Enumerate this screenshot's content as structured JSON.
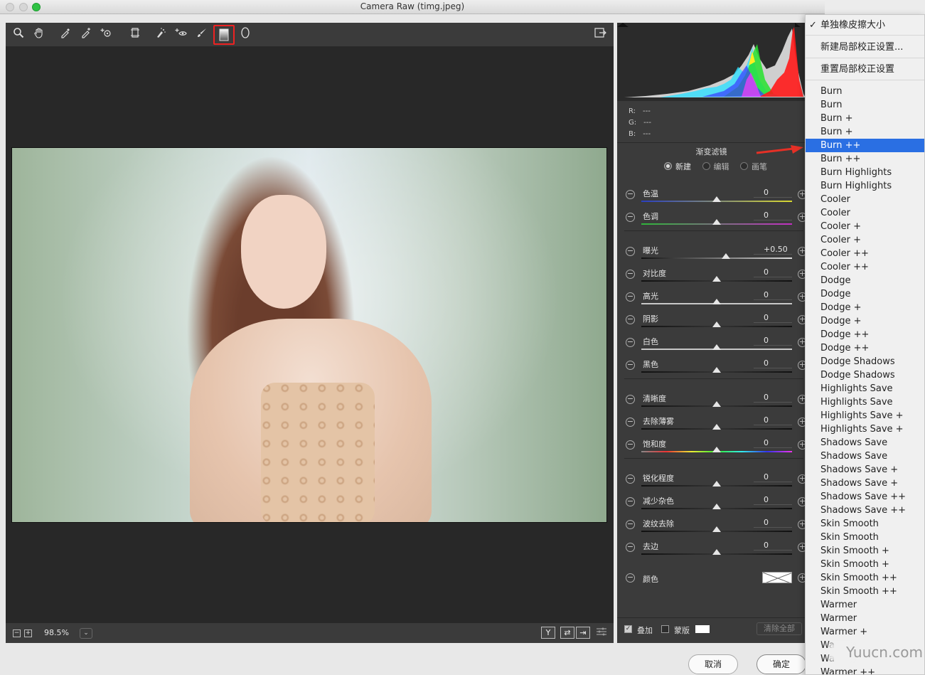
{
  "window": {
    "title": "Camera Raw (timg.jpeg)"
  },
  "toolbar": {
    "tools": [
      "zoom-icon",
      "hand-icon",
      "white-balance-icon",
      "color-sampler-icon",
      "targeted-adjustment-icon",
      "transform-icon",
      "spot-removal-icon",
      "red-eye-icon",
      "adjustment-brush-icon",
      "graduated-filter-icon",
      "radial-filter-icon"
    ],
    "active_tool": "graduated-filter-icon"
  },
  "status": {
    "zoom": "98.5%"
  },
  "histogram": {
    "r_label": "R:",
    "g_label": "G:",
    "b_label": "B:",
    "r": "---",
    "g": "---",
    "b": "---"
  },
  "panel": {
    "title": "渐变滤镜",
    "modes": [
      {
        "label": "新建",
        "selected": true
      },
      {
        "label": "编辑",
        "selected": false
      },
      {
        "label": "画笔",
        "selected": false
      }
    ],
    "sliders": [
      {
        "label": "色温",
        "value": "0",
        "level": 0.5,
        "track": "temp"
      },
      {
        "label": "色调",
        "value": "0",
        "level": 0.5,
        "track": "tint"
      },
      {
        "label": "曝光",
        "value": "+0.50",
        "level": 0.56,
        "track": "exposure"
      },
      {
        "label": "对比度",
        "value": "0",
        "level": 0.5,
        "track": "dark"
      },
      {
        "label": "高光",
        "value": "0",
        "level": 0.5,
        "track": "light"
      },
      {
        "label": "阴影",
        "value": "0",
        "level": 0.5,
        "track": "dark"
      },
      {
        "label": "白色",
        "value": "0",
        "level": 0.5,
        "track": "light"
      },
      {
        "label": "黑色",
        "value": "0",
        "level": 0.5,
        "track": "dark"
      },
      {
        "label": "清晰度",
        "value": "0",
        "level": 0.5,
        "track": "dark"
      },
      {
        "label": "去除薄雾",
        "value": "0",
        "level": 0.5,
        "track": "dark"
      },
      {
        "label": "饱和度",
        "value": "0",
        "level": 0.5,
        "track": "sat"
      },
      {
        "label": "锐化程度",
        "value": "0",
        "level": 0.5,
        "track": "dark"
      },
      {
        "label": "减少杂色",
        "value": "0",
        "level": 0.5,
        "track": "dark"
      },
      {
        "label": "波纹去除",
        "value": "0",
        "level": 0.5,
        "track": "dark"
      },
      {
        "label": "去边",
        "value": "0",
        "level": 0.5,
        "track": "dark"
      }
    ],
    "color_label": "颜色",
    "overlay_label": "叠加",
    "mask_label": "蒙版",
    "clear_all": "清除全部"
  },
  "buttons": {
    "cancel": "取消",
    "ok": "确定"
  },
  "menu": {
    "top_items": [
      "单独橡皮擦大小",
      "新建局部校正设置...",
      "重置局部校正设置"
    ],
    "checked_index": 0,
    "presets": [
      "Burn",
      "Burn",
      "Burn +",
      "Burn +",
      "Burn ++",
      "Burn ++",
      "Burn Highlights",
      "Burn Highlights",
      "Cooler",
      "Cooler",
      "Cooler +",
      "Cooler +",
      "Cooler ++",
      "Cooler ++",
      "Dodge",
      "Dodge",
      "Dodge +",
      "Dodge +",
      "Dodge ++",
      "Dodge ++",
      "Dodge Shadows",
      "Dodge Shadows",
      "Highlights Save",
      "Highlights Save",
      "Highlights Save +",
      "Highlights Save +",
      "Shadows Save",
      "Shadows Save",
      "Shadows Save +",
      "Shadows Save +",
      "Shadows Save ++",
      "Shadows Save ++",
      "Skin Smooth",
      "Skin Smooth",
      "Skin Smooth +",
      "Skin Smooth +",
      "Skin Smooth ++",
      "Skin Smooth ++",
      "Warmer",
      "Warmer",
      "Warmer +",
      "Wa",
      "Wa",
      "Warmer ++"
    ],
    "highlighted_index": 4
  },
  "watermark": "Yuucn.com",
  "colors": {
    "highlight": "#2a6fe3",
    "active_tool_outline": "#ee2222",
    "arrow": "#e53026"
  }
}
